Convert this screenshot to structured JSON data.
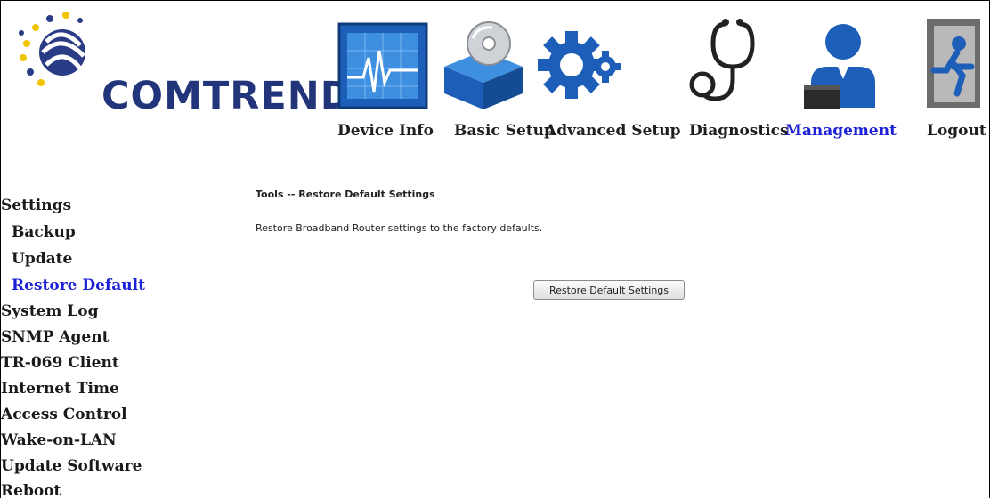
{
  "brand": {
    "name": "COMTREND"
  },
  "nav": {
    "items": [
      {
        "label": "Device Info",
        "icon": "chart-monitor-icon"
      },
      {
        "label": "Basic Setup",
        "icon": "software-box-icon"
      },
      {
        "label": "Advanced Setup",
        "icon": "gears-icon"
      },
      {
        "label": "Diagnostics",
        "icon": "stethoscope-icon"
      },
      {
        "label": "Management",
        "icon": "user-management-icon",
        "active": true
      },
      {
        "label": "Logout",
        "icon": "exit-door-icon"
      }
    ]
  },
  "sidebar": {
    "items": [
      {
        "label": "Settings"
      },
      {
        "label": "Backup"
      },
      {
        "label": "Update"
      },
      {
        "label": "Restore Default",
        "active": true
      },
      {
        "label": "System Log"
      },
      {
        "label": "SNMP Agent"
      },
      {
        "label": "TR-069 Client"
      },
      {
        "label": "Internet Time"
      },
      {
        "label": "Access Control"
      },
      {
        "label": "Wake-on-LAN"
      },
      {
        "label": "Update Software"
      },
      {
        "label": "Reboot"
      }
    ]
  },
  "main": {
    "title": "Tools -- Restore Default Settings",
    "description": "Restore Broadband Router settings to the factory defaults.",
    "button_label": "Restore Default Settings"
  },
  "colors": {
    "active_link": "#1d20d6",
    "brand_blue": "#23357a"
  }
}
